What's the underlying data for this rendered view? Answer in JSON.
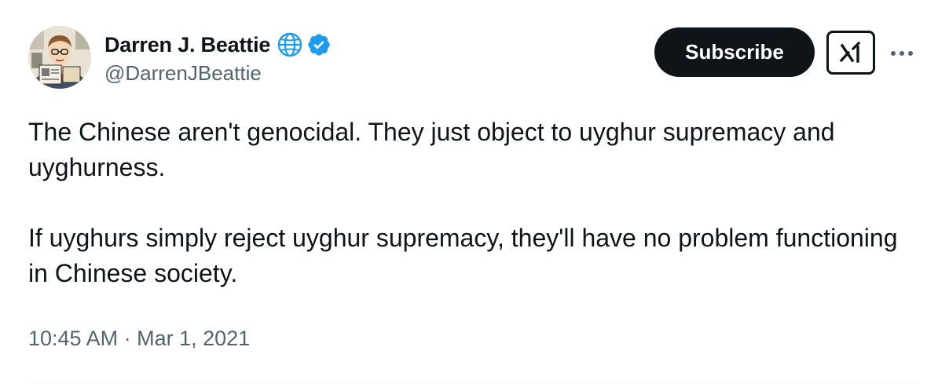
{
  "author": {
    "display_name": "Darren J. Beattie",
    "handle": "@DarrenJBeattie",
    "avatar_icon": "cartoon-reader-avatar",
    "affiliation_icon": "globe-icon",
    "verified_icon": "verified-badge-icon",
    "verified_color": "#1d9bf0"
  },
  "actions": {
    "subscribe_label": "Subscribe",
    "grok_icon": "grok-icon",
    "more_icon": "more-dots-icon"
  },
  "tweet": {
    "paragraphs": [
      "The Chinese aren't genocidal. They just object to uyghur supremacy and uyghurness.",
      "If uyghurs simply reject uyghur supremacy, they'll have no problem functioning in Chinese society."
    ],
    "timestamp": "10:45 AM · Mar 1, 2021"
  },
  "colors": {
    "text_primary": "#0f1419",
    "text_secondary": "#536471",
    "button_bg": "#0f1419",
    "divider": "#eff3f4"
  }
}
